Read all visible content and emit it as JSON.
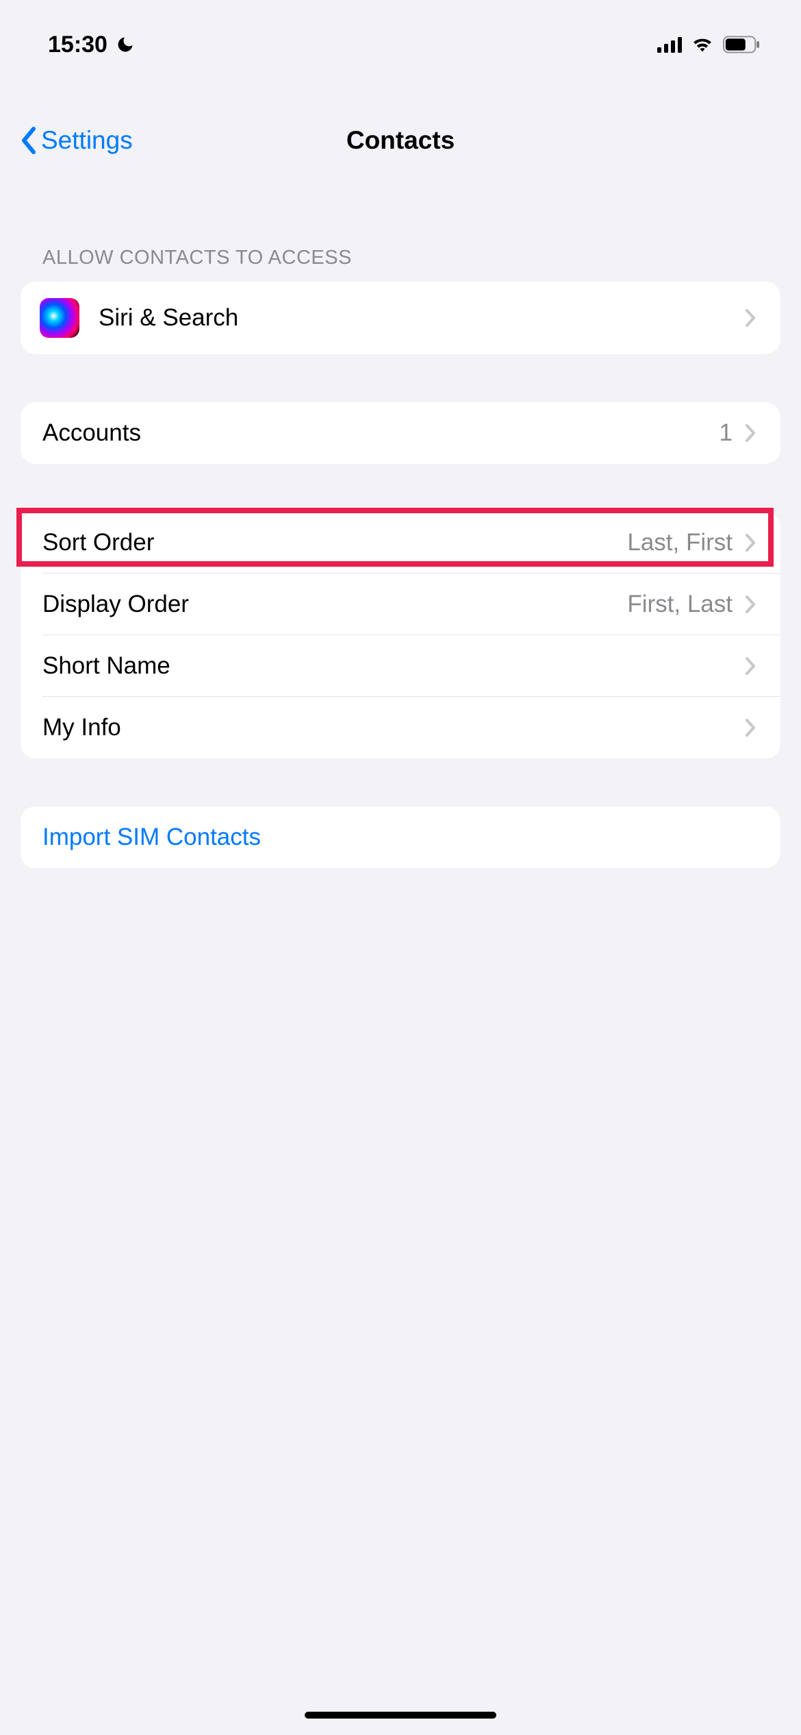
{
  "status_bar": {
    "time": "15:30"
  },
  "nav": {
    "back_label": "Settings",
    "title": "Contacts"
  },
  "sections": {
    "access_header": "Allow Contacts to Access",
    "siri_search": "Siri & Search",
    "accounts": {
      "label": "Accounts",
      "value": "1"
    },
    "sort_order": {
      "label": "Sort Order",
      "value": "Last, First"
    },
    "display_order": {
      "label": "Display Order",
      "value": "First, Last"
    },
    "short_name": "Short Name",
    "my_info": "My Info",
    "import_sim": "Import SIM Contacts"
  }
}
